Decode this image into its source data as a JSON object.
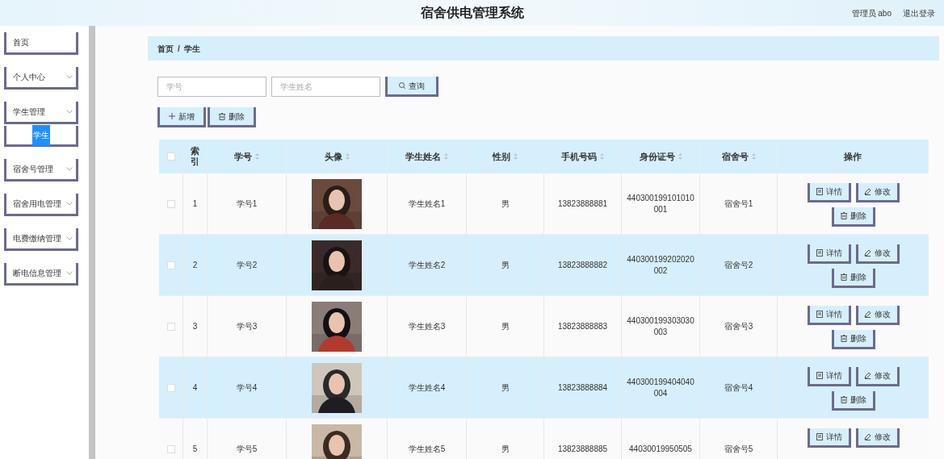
{
  "header": {
    "title": "宿舍供电管理系统",
    "user": "管理员 abo",
    "logout": "退出登录"
  },
  "sidebar": {
    "items": [
      {
        "label": "首页",
        "kind": "link"
      },
      {
        "label": "个人中心",
        "kind": "group"
      },
      {
        "label": "学生管理",
        "kind": "group",
        "children": [
          {
            "label": "学生",
            "selected": true
          }
        ]
      },
      {
        "label": "宿舍号管理",
        "kind": "group"
      },
      {
        "label": "宿舍用电管理",
        "kind": "group"
      },
      {
        "label": "电费缴纳管理",
        "kind": "group"
      },
      {
        "label": "断电信息管理",
        "kind": "group"
      }
    ]
  },
  "breadcrumb": {
    "items": [
      "首页",
      "学生"
    ],
    "separator": "/"
  },
  "search": {
    "fields": [
      {
        "placeholder": "学号"
      },
      {
        "placeholder": "学生姓名"
      }
    ],
    "button": "查询"
  },
  "toolbar": [
    {
      "label": "新增",
      "kind": "add"
    },
    {
      "label": "删除",
      "kind": "delete"
    }
  ],
  "table": {
    "select_all": {
      "checked": false
    },
    "columns": [
      {
        "label": "索引",
        "sortable": false
      },
      {
        "label": "学号",
        "sortable": true
      },
      {
        "label": "头像",
        "sortable": true
      },
      {
        "label": "学生姓名",
        "sortable": true
      },
      {
        "label": "性别",
        "sortable": true
      },
      {
        "label": "手机号码",
        "sortable": true
      },
      {
        "label": "身份证号",
        "sortable": true
      },
      {
        "label": "宿舍号",
        "sortable": true
      },
      {
        "label": "操作",
        "sortable": false
      }
    ],
    "rows": [
      {
        "checked": false,
        "highlighted": false,
        "cells": [
          "1",
          "学号1",
          {
            "kind": "picture"
          },
          "学生姓名1",
          "男",
          "13823888881",
          "440300199101010001",
          "宿舍号1"
        ],
        "actions": [
          {
            "label": "详情",
            "kind": "detail"
          },
          {
            "label": "修改",
            "kind": "edit"
          },
          {
            "label": "删除",
            "kind": "delete"
          }
        ]
      },
      {
        "checked": false,
        "highlighted": true,
        "cells": [
          "2",
          "学号2",
          {
            "kind": "picture"
          },
          "学生姓名2",
          "男",
          "13823888882",
          "440300199202020002",
          "宿舍号2"
        ],
        "actions": [
          {
            "label": "详情",
            "kind": "detail"
          },
          {
            "label": "修改",
            "kind": "edit"
          },
          {
            "label": "删除",
            "kind": "delete"
          }
        ]
      },
      {
        "checked": false,
        "highlighted": false,
        "cells": [
          "3",
          "学号3",
          {
            "kind": "picture"
          },
          "学生姓名3",
          "男",
          "13823888883",
          "440300199303030003",
          "宿舍号3"
        ],
        "actions": [
          {
            "label": "详情",
            "kind": "detail"
          },
          {
            "label": "修改",
            "kind": "edit"
          },
          {
            "label": "删除",
            "kind": "delete"
          }
        ]
      },
      {
        "checked": false,
        "highlighted": true,
        "cells": [
          "4",
          "学号4",
          {
            "kind": "picture"
          },
          "学生姓名4",
          "男",
          "13823888884",
          "440300199404040004",
          "宿舍号4"
        ],
        "actions": [
          {
            "label": "详情",
            "kind": "detail"
          },
          {
            "label": "修改",
            "kind": "edit"
          },
          {
            "label": "删除",
            "kind": "delete"
          }
        ]
      },
      {
        "checked": false,
        "highlighted": false,
        "cells": [
          "5",
          "学号5",
          {
            "kind": "picture"
          },
          "学生姓名5",
          "男",
          "13823888885",
          "44030019950505",
          "宿舍号5"
        ],
        "actions": [
          {
            "label": "详情",
            "kind": "detail"
          },
          {
            "label": "修改",
            "kind": "edit"
          }
        ]
      }
    ]
  }
}
